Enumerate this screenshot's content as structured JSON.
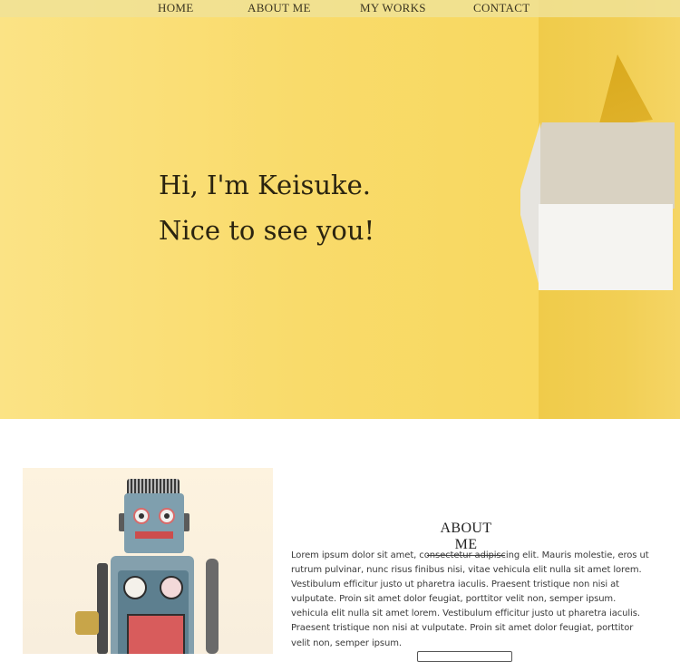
{
  "nav": {
    "items": [
      "HOME",
      "ABOUT ME",
      "MY WORKS",
      "CONTACT"
    ]
  },
  "hero": {
    "line1": "Hi, I'm Keisuke.",
    "line2": "Nice to see you!"
  },
  "about": {
    "title": "ABOUT ME",
    "text": "Lorem ipsum dolor sit amet, consectetur adipiscing elit. Mauris molestie, eros ut rutrum pulvinar, nunc risus finibus nisi, vitae vehicula elit nulla sit amet lorem. Vestibulum efficitur justo ut pharetra iaculis. Praesent tristique non nisi at vulputate. Proin sit amet dolor feugiat, porttitor velit non, semper ipsum. vehicula elit nulla sit amet lorem. Vestibulum efficitur justo ut pharetra iaculis. Praesent tristique non nisi at vulputate. Proin sit amet dolor feugiat, porttitor velit non, semper ipsum."
  },
  "colors": {
    "hero_yellow": "#f9dc6e",
    "nav_bar": "#f0e296",
    "text_dark": "#2b2410"
  }
}
